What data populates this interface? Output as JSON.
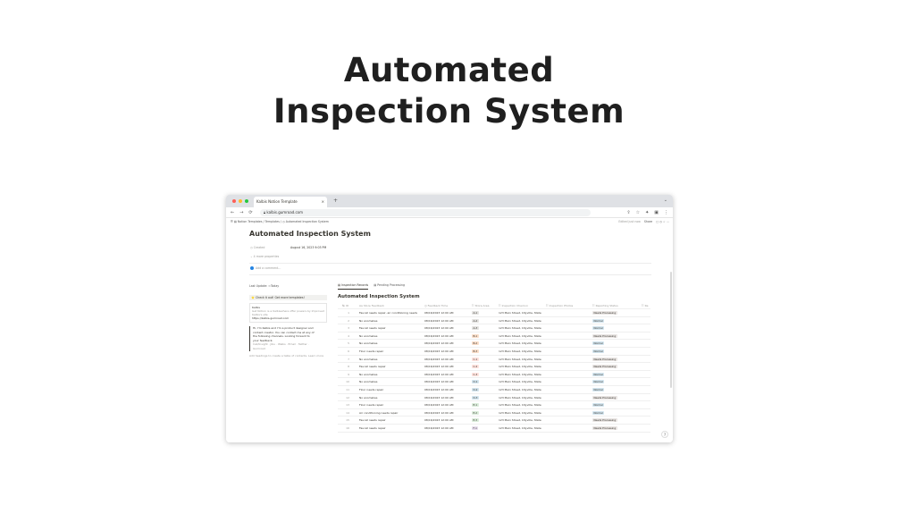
{
  "hero": {
    "line1": "Automated",
    "line2": "Inspection System"
  },
  "browser": {
    "tab_title": "Kalbis Notion Template",
    "tab_close": "×",
    "new_tab": "+",
    "url": "kalbis.gumroad.com",
    "nav": {
      "back": "←",
      "forward": "→",
      "reload": "⟳"
    },
    "icons": {
      "share": "⇪",
      "star": "☆",
      "ext": "✦",
      "panel": "▣",
      "menu": "⋮"
    },
    "colors": {
      "red": "#ff5f57",
      "yellow": "#febc2e",
      "green": "#28c840"
    }
  },
  "notion": {
    "breadcrumb": "☰  ▤ Notion Templates  /  Templates  /  ◷ Automated Inspection System",
    "edited": "Edited just now",
    "share": "Share",
    "top_icons": "▢  ◷  ☆  ⋯",
    "title": "Automated Inspection System",
    "created_label": "◷  Created",
    "created_value": "August 16, 2023 9:03 PM",
    "more_props": "⌄  4 more properties",
    "add_comment": "Add a comment...",
    "last_update": "Last Update:  ≈Today",
    "callout": "⭐ Check it out! Get more templates!",
    "card_title": "Kalbis",
    "card_sub": "Get Notion is a Kalbiswhere offer powers by Improved Kalbis's site",
    "card_link": "https://kalbis.gumroad.com",
    "quote_lines": [
      "Hi, I'm Kalbis and I'm a product designer and",
      "content creator. You can contact me at any of",
      "the following channels. Looking forward to",
      "your feedback.",
      "Inst/Insight   ·  Jibu  ·  Walks  ·  Email  ·  Twitter  ·",
      "Gumroad"
    ],
    "footer": "Add headings to create a table of contents. Learn more",
    "tabs": [
      "▤ Inspection Records",
      "▤ Pending Processing"
    ],
    "db_title": "Automated Inspection System",
    "columns": [
      "№  ID",
      "Aa  Store Feedback",
      "◷  Feedback Time",
      "☷  Store Area",
      "☷  Inspection Check-in",
      "☷  Inspection Photos",
      "☷  Reporting Status",
      "☷  Re"
    ],
    "rows": [
      [
        "1",
        "Faucet needs repair, air conditioning needs",
        "08/16/2023 12:00 AM",
        "A-1",
        "123 Main Street, Cityville, State",
        "Needs Processing"
      ],
      [
        "2",
        "No anomalies",
        "08/16/2023 12:00 AM",
        "A-2",
        "123 Main Street, Cityville, State",
        "Normal"
      ],
      [
        "3",
        "Faucet needs repair",
        "08/16/2023 12:00 AM",
        "A-3",
        "123 Main Street, Cityville, State",
        "Normal"
      ],
      [
        "4",
        "No anomalies",
        "08/16/2023 12:00 AM",
        "B-1",
        "123 Main Street, Cityville, State",
        "Needs Processing"
      ],
      [
        "5",
        "No anomalies",
        "08/16/2023 12:00 AM",
        "B-2",
        "123 Main Street, Cityville, State",
        "Normal"
      ],
      [
        "6",
        "Floor needs repair",
        "08/16/2023 12:00 AM",
        "B-3",
        "123 Main Street, Cityville, State",
        "Normal"
      ],
      [
        "7",
        "No anomalies",
        "08/16/2023 12:00 AM",
        "C-1",
        "123 Main Street, Cityville, State",
        "Needs Processing"
      ],
      [
        "8",
        "Faucet needs repair",
        "08/16/2023 12:00 AM",
        "C-2",
        "123 Main Street, Cityville, State",
        "Needs Processing"
      ],
      [
        "9",
        "No anomalies",
        "08/16/2023 12:00 AM",
        "C-3",
        "123 Main Street, Cityville, State",
        "Normal"
      ],
      [
        "10",
        "No anomalies",
        "08/16/2023 12:00 AM",
        "D-1",
        "123 Main Street, Cityville, State",
        "Normal"
      ],
      [
        "11",
        "Floor needs repair",
        "08/16/2023 12:00 AM",
        "D-2",
        "123 Main Street, Cityville, State",
        "Normal"
      ],
      [
        "12",
        "No anomalies",
        "08/16/2023 12:00 AM",
        "D-3",
        "123 Main Street, Cityville, State",
        "Needs Processing"
      ],
      [
        "13",
        "Floor needs repair",
        "08/16/2023 12:00 AM",
        "E-1",
        "123 Main Street, Cityville, State",
        "Normal"
      ],
      [
        "14",
        "Air conditioning needs repair",
        "08/16/2023 12:00 AM",
        "E-2",
        "123 Main Street, Cityville, State",
        "Normal"
      ],
      [
        "15",
        "Faucet needs repair",
        "08/16/2023 12:00 AM",
        "E-3",
        "123 Main Street, Cityville, State",
        "Needs Processing"
      ],
      [
        "16",
        "Faucet needs repair",
        "08/16/2023 12:00 AM",
        "F-1",
        "123 Main Street, Cityville, State",
        "Needs Processing"
      ]
    ],
    "status_colors": {
      "Needs Processing": "#e9e5e3",
      "Normal": "#d3e5ef"
    },
    "area_colors": {
      "A": "#e3e2e0",
      "B": "#fadec9",
      "C": "#ffe2dd",
      "D": "#d3e5ef",
      "E": "#dbeddb",
      "F": "#e8deee"
    },
    "help": "?"
  }
}
